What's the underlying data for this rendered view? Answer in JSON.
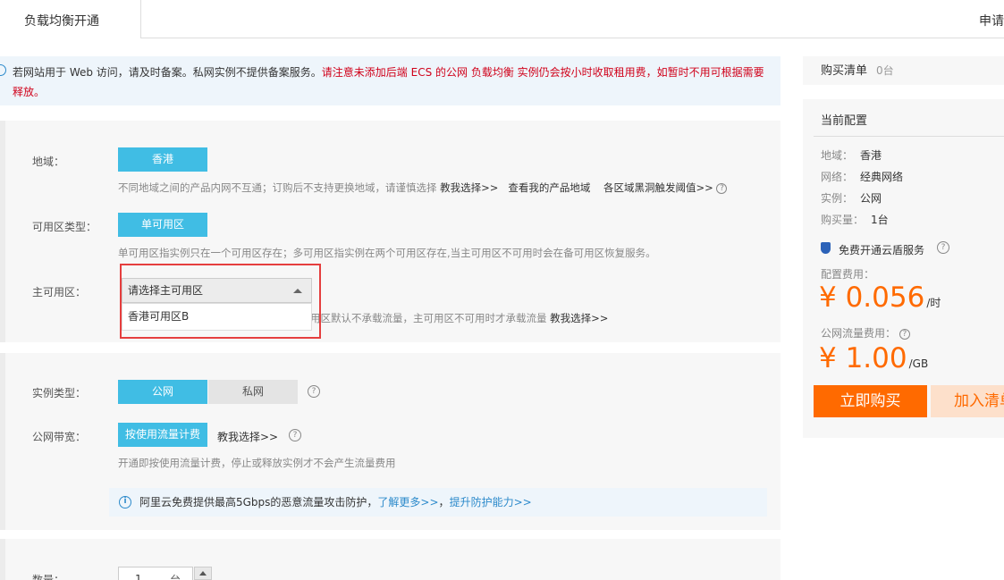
{
  "tabs": {
    "active": "负载均衡开通",
    "right": "申请"
  },
  "notice": {
    "normal": "若网站用于 Web 访问，请及时备案。私网实例不提供备案服务。",
    "warning": "请注意未添加后端 ECS 的公网 负载均衡 实例仍会按小时收取租用费，如暂时不用可根据需要释放。"
  },
  "region": {
    "label": "地域：",
    "selected": "香港",
    "hint": "不同地域之间的产品内网不互通；订购后不支持更换地域，请谨慎选择",
    "link1": "教我选择>>",
    "link2": "查看我的产品地域",
    "link3": "各区域黑洞触发阈值>>"
  },
  "zone_type": {
    "label": "可用区类型：",
    "selected": "单可用区",
    "hint": "单可用区指实例只在一个可用区存在；多可用区指实例在两个可用区存在,当主可用区不可用时会在备可用区恢复服务。"
  },
  "main_zone": {
    "label": "主可用区：",
    "placeholder": "请选择主可用区",
    "option": "香港可用区B",
    "hint_tail": "用区默认不承载流量，主可用区不可用时才承载流量",
    "link": "教我选择>>"
  },
  "instance_type": {
    "label": "实例类型：",
    "public": "公网",
    "private": "私网"
  },
  "bandwidth": {
    "label": "公网带宽：",
    "selected": "按使用流量计费",
    "link": "教我选择>>",
    "hint": "开通即按使用流量计费，停止或释放实例才不会产生流量费用"
  },
  "ddos": {
    "text": "阿里云免费提供最高5Gbps的恶意流量攻击防护，",
    "link1": "了解更多>>",
    "sep": "，",
    "link2": "提升防护能力>>"
  },
  "quantity": {
    "label": "数量：",
    "value": "1",
    "unit": "台"
  },
  "cart": {
    "title": "购买清单",
    "count": "0台"
  },
  "config": {
    "title": "当前配置",
    "rows": [
      {
        "k": "地域：",
        "v": "香港"
      },
      {
        "k": "网络：",
        "v": "经典网络"
      },
      {
        "k": "实例：",
        "v": "公网"
      },
      {
        "k": "购买量：",
        "v": "1台"
      }
    ],
    "shield_text": "免费开通云盾服务",
    "fee_label": "配置费用：",
    "fee_value": "¥ 0.056",
    "fee_unit": "/时",
    "traffic_label": "公网流量费用：",
    "traffic_value": "¥ 1.00",
    "traffic_unit": "/GB",
    "buy": "立即购买",
    "add_cart": "加入清单"
  }
}
